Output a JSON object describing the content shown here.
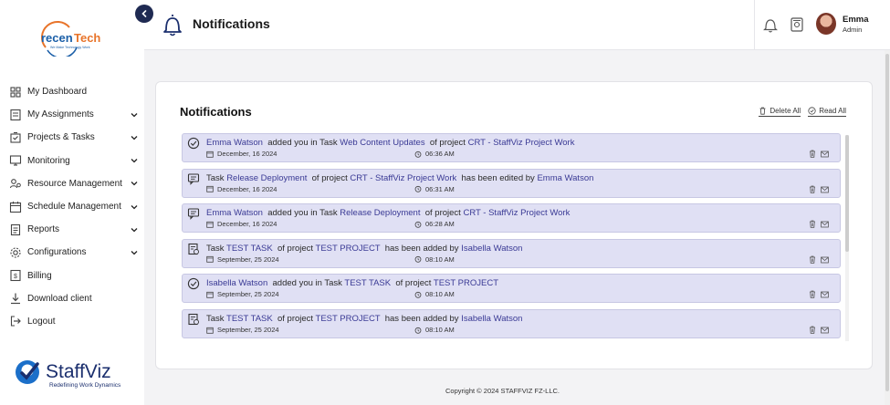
{
  "brand": {
    "logo_text_main": "recenTech",
    "logo_text_tag": "We Make Technology Work",
    "footer_logo_main": "StaffViz",
    "footer_logo_tag": "Redefining Work Dynamics"
  },
  "sidebar": {
    "items": [
      {
        "label": "My Dashboard",
        "icon": "dashboard-icon",
        "has_chevron": false
      },
      {
        "label": "My Assignments",
        "icon": "assignments-icon",
        "has_chevron": true
      },
      {
        "label": "Projects & Tasks",
        "icon": "projects-icon",
        "has_chevron": true
      },
      {
        "label": "Monitoring",
        "icon": "monitor-icon",
        "has_chevron": true
      },
      {
        "label": "Resource Management",
        "icon": "resource-icon",
        "has_chevron": true
      },
      {
        "label": "Schedule Management",
        "icon": "schedule-icon",
        "has_chevron": true
      },
      {
        "label": "Reports",
        "icon": "reports-icon",
        "has_chevron": true
      },
      {
        "label": "Configurations",
        "icon": "config-icon",
        "has_chevron": true
      },
      {
        "label": "Billing",
        "icon": "billing-icon",
        "has_chevron": false
      },
      {
        "label": "Download client",
        "icon": "download-icon",
        "has_chevron": false
      },
      {
        "label": "Logout",
        "icon": "logout-icon",
        "has_chevron": false
      }
    ]
  },
  "header": {
    "title": "Notifications",
    "user_name": "Emma",
    "user_role": "Admin"
  },
  "card": {
    "title": "Notifications",
    "delete_all": "Delete All",
    "read_all": "Read All"
  },
  "notifications": [
    {
      "icon": "check-circle-icon",
      "parts": [
        [
          "hl",
          "Emma Watson"
        ],
        [
          "t",
          "  added you in Task "
        ],
        [
          "hl",
          "Web Content Updates"
        ],
        [
          "t",
          "  of project "
        ],
        [
          "hl",
          "CRT - StaffViz Project Work"
        ]
      ],
      "date": "December, 16 2024",
      "time": "06:36 AM"
    },
    {
      "icon": "comment-icon",
      "parts": [
        [
          "t",
          "Task "
        ],
        [
          "hl",
          "Release Deployment"
        ],
        [
          "t",
          "  of project "
        ],
        [
          "hl",
          "CRT - StaffViz Project Work"
        ],
        [
          "t",
          "  has been edited by "
        ],
        [
          "hl",
          "Emma Watson"
        ]
      ],
      "date": "December, 16 2024",
      "time": "06:31 AM"
    },
    {
      "icon": "comment-icon",
      "parts": [
        [
          "hl",
          "Emma Watson"
        ],
        [
          "t",
          "  added you in Task "
        ],
        [
          "hl",
          "Release Deployment"
        ],
        [
          "t",
          "  of project "
        ],
        [
          "hl",
          "CRT - StaffViz Project Work"
        ]
      ],
      "date": "December, 16 2024",
      "time": "06:28 AM"
    },
    {
      "icon": "task-icon",
      "parts": [
        [
          "t",
          "Task "
        ],
        [
          "hl",
          "TEST TASK"
        ],
        [
          "t",
          "  of project "
        ],
        [
          "hl",
          "TEST PROJECT"
        ],
        [
          "t",
          "  has been added by "
        ],
        [
          "hl",
          "Isabella Watson"
        ]
      ],
      "date": "September, 25 2024",
      "time": "08:10 AM"
    },
    {
      "icon": "check-circle-icon",
      "parts": [
        [
          "hl",
          "Isabella Watson"
        ],
        [
          "t",
          "  added you in Task "
        ],
        [
          "hl",
          "TEST TASK"
        ],
        [
          "t",
          "  of project "
        ],
        [
          "hl",
          "TEST PROJECT"
        ]
      ],
      "date": "September, 25 2024",
      "time": "08:10 AM"
    },
    {
      "icon": "task-icon",
      "parts": [
        [
          "t",
          "Task "
        ],
        [
          "hl",
          "TEST TASK"
        ],
        [
          "t",
          "  of project "
        ],
        [
          "hl",
          "TEST PROJECT"
        ],
        [
          "t",
          "  has been added by "
        ],
        [
          "hl",
          "Isabella Watson"
        ]
      ],
      "date": "September, 25 2024",
      "time": "08:10 AM"
    }
  ],
  "footer": {
    "copyright": "Copyright © 2024 STAFFVIZ FZ-LLC."
  },
  "colors": {
    "accent": "#1f2a52",
    "notification_bg": "#e0e0f4",
    "highlight_text": "#3a3a95"
  }
}
